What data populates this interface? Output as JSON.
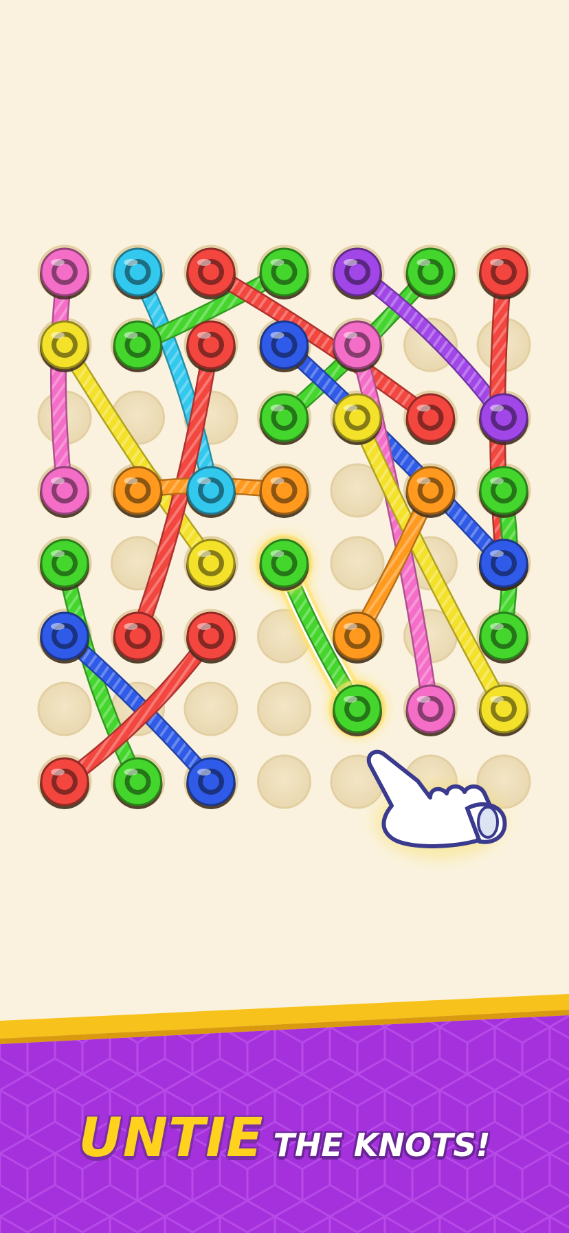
{
  "colors": {
    "background": "#FAF2DE",
    "banner_purple": "#A531DC",
    "banner_gold": "#F7C21B",
    "caption_yellow": "#FFD21E",
    "caption_white": "#FFFFFF"
  },
  "game": {
    "grid": {
      "columns": 7,
      "rows": 8
    },
    "empty_holes": [
      [
        2,
        0
      ],
      [
        2,
        2
      ],
      [
        2,
        3
      ],
      [
        3,
        4
      ],
      [
        3,
        5
      ],
      [
        4,
        5
      ],
      [
        4,
        0
      ],
      [
        5,
        1
      ],
      [
        5,
        3
      ],
      [
        6,
        0
      ],
      [
        6,
        1
      ],
      [
        6,
        2
      ],
      [
        6,
        3
      ],
      [
        6,
        4
      ],
      [
        7,
        3
      ],
      [
        7,
        4
      ],
      [
        7,
        5
      ],
      [
        7,
        6
      ],
      [
        1,
        5
      ],
      [
        1,
        6
      ],
      [
        3,
        1
      ],
      [
        3,
        4
      ]
    ],
    "ropes": [
      {
        "color": "pink",
        "hex": "#F46EC8",
        "from": [
          0,
          0
        ],
        "to": [
          3,
          0
        ]
      },
      {
        "color": "yellow",
        "hex": "#F4E12A",
        "from": [
          1,
          0
        ],
        "to": [
          4,
          2
        ]
      },
      {
        "color": "cyan",
        "hex": "#33C8EE",
        "from": [
          0,
          1
        ],
        "to": [
          3,
          2
        ]
      },
      {
        "color": "green",
        "hex": "#44D62C",
        "from": [
          1,
          1
        ],
        "to": [
          0,
          3
        ]
      },
      {
        "color": "red",
        "hex": "#F2463F",
        "from": [
          0,
          2
        ],
        "to": [
          2,
          5
        ]
      },
      {
        "color": "red",
        "hex": "#F2463F",
        "from": [
          1,
          2
        ],
        "to": [
          5,
          1
        ]
      },
      {
        "color": "orange",
        "hex": "#FF9A1F",
        "from": [
          3,
          1
        ],
        "to": [
          3,
          3
        ]
      },
      {
        "color": "green",
        "hex": "#44D62C",
        "from": [
          2,
          3
        ],
        "to": [
          0,
          5
        ]
      },
      {
        "color": "purple",
        "hex": "#A147E8",
        "from": [
          0,
          4
        ],
        "to": [
          2,
          6
        ]
      },
      {
        "color": "red",
        "hex": "#F2463F",
        "from": [
          0,
          6
        ],
        "to": [
          4,
          6
        ]
      },
      {
        "color": "blue",
        "hex": "#2F5BE8",
        "from": [
          1,
          3
        ],
        "to": [
          4,
          6
        ]
      },
      {
        "color": "pink",
        "hex": "#F46EC8",
        "from": [
          1,
          4
        ],
        "to": [
          6,
          5
        ]
      },
      {
        "color": "yellow",
        "hex": "#F4E12A",
        "from": [
          2,
          4
        ],
        "to": [
          6,
          6
        ]
      },
      {
        "color": "orange",
        "hex": "#FF9A1F",
        "from": [
          3,
          5
        ],
        "to": [
          5,
          4
        ]
      },
      {
        "color": "green",
        "hex": "#44D62C",
        "from": [
          3,
          6
        ],
        "to": [
          5,
          6
        ]
      },
      {
        "color": "green",
        "hex": "#44D62C",
        "from": [
          4,
          0
        ],
        "to": [
          7,
          1
        ]
      },
      {
        "color": "blue",
        "hex": "#2F5BE8",
        "from": [
          5,
          0
        ],
        "to": [
          7,
          2
        ]
      },
      {
        "color": "red",
        "hex": "#F2463F",
        "from": [
          5,
          2
        ],
        "to": [
          7,
          0
        ]
      },
      {
        "color": "green",
        "hex": "#44D62C",
        "from": [
          4,
          3
        ],
        "to": [
          6,
          4
        ],
        "selected": true
      }
    ],
    "hint": "hand-pointer"
  },
  "banner": {
    "title_big": "UNTIE",
    "title_small": "THE KNOTS!"
  }
}
